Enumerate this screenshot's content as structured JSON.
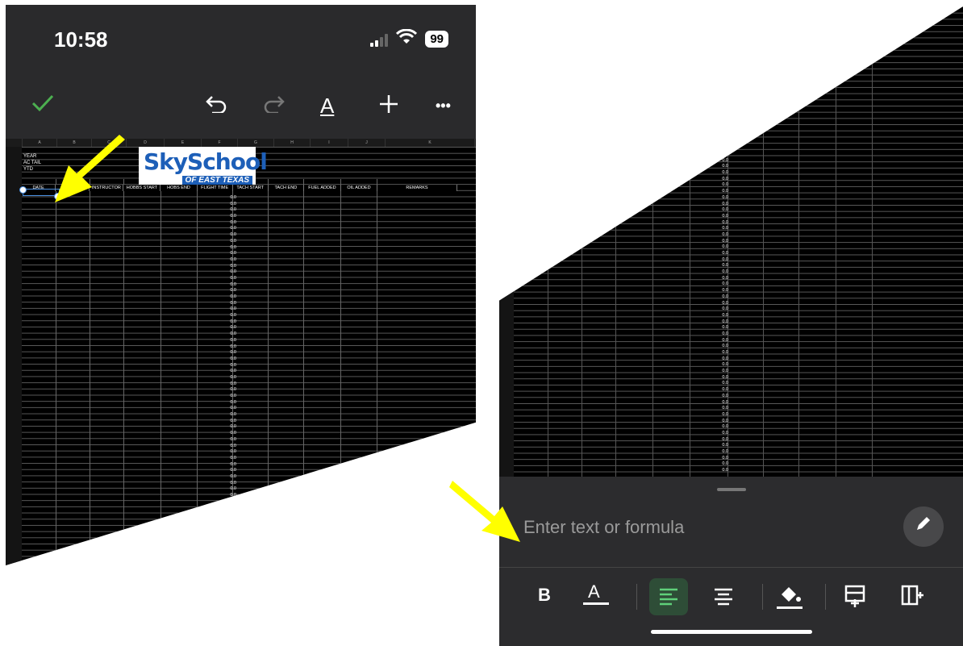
{
  "status_bar": {
    "time": "10:58",
    "battery": "99"
  },
  "toolbar": {
    "confirm_icon": "checkmark-icon",
    "undo_icon": "undo-icon",
    "redo_icon": "redo-icon",
    "text_format_label": "A",
    "add_icon": "plus-icon",
    "more_label": "•••"
  },
  "spreadsheet": {
    "column_letters": [
      "A",
      "B",
      "C",
      "D",
      "E",
      "F",
      "G",
      "H",
      "I",
      "J",
      "K"
    ],
    "info_labels": [
      "YEAR",
      "AC TAIL",
      "YTD"
    ],
    "headers": [
      "DATE",
      "",
      "INSTRUCTOR",
      "HOBBS START",
      "HOBS END",
      "FLIGHT TIME",
      "TACH START",
      "TACH END",
      "FUEL ADDED",
      "OIL ADDED",
      "REMARKS"
    ],
    "flight_time_value": "0.0"
  },
  "logo": {
    "main": "SkySchool",
    "sub": "OF EAST TEXAS"
  },
  "editor": {
    "formula_placeholder": "Enter text or formula",
    "bold_label": "B",
    "text_color_label": "A"
  },
  "colors": {
    "accent_green": "#4caf50",
    "arrow_yellow": "#ffff00",
    "selection_blue": "#4a90e2"
  }
}
